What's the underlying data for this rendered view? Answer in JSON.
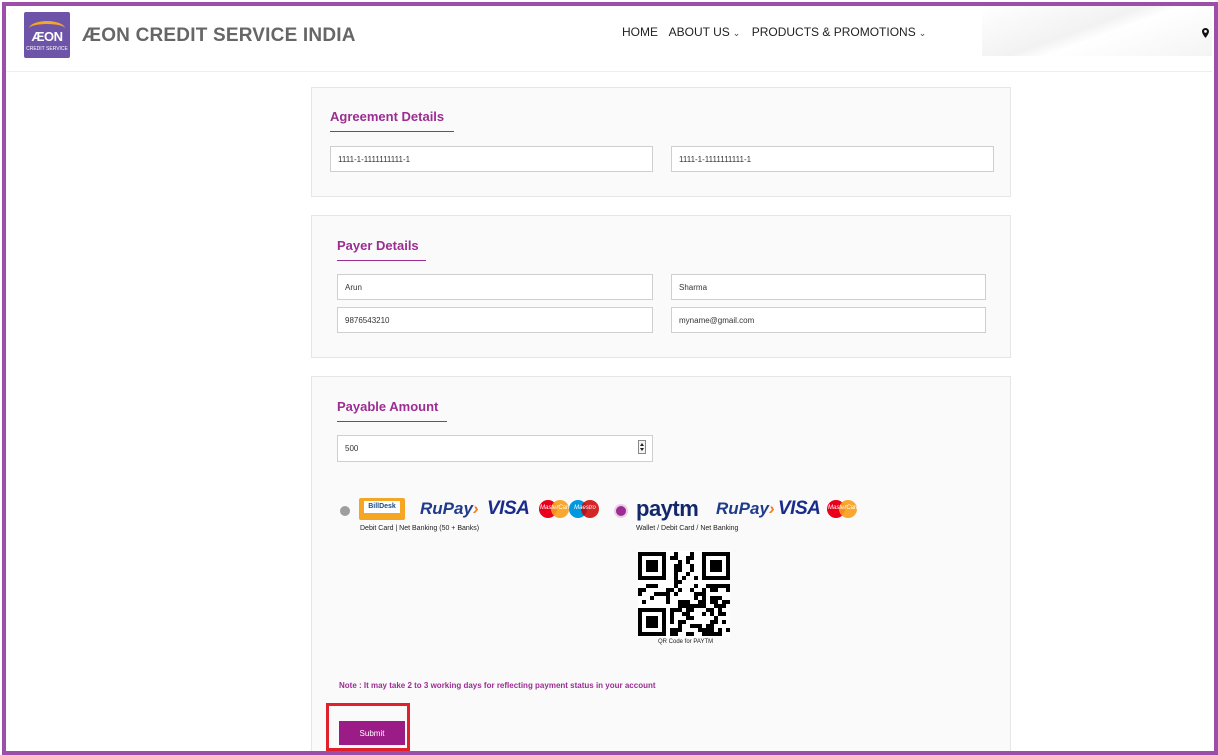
{
  "header": {
    "logo_text": "ÆON",
    "logo_sub": "CREDIT SERVICE",
    "brand": "ÆON CREDIT SERVICE INDIA",
    "nav": [
      {
        "label": "HOME",
        "has_dropdown": false
      },
      {
        "label": "ABOUT US",
        "has_dropdown": true
      },
      {
        "label": "PRODUCTS & PROMOTIONS",
        "has_dropdown": true
      }
    ],
    "pin_icon": "location-pin-icon"
  },
  "agreement": {
    "title": "Agreement Details",
    "field1": "1111-1-1111111111-1",
    "field2": "1111-1-1111111111-1"
  },
  "payer": {
    "title": "Payer Details",
    "first_name": "Arun",
    "last_name": "Sharma",
    "phone": "9876543210",
    "email": "myname@gmail.com"
  },
  "payable": {
    "title": "Payable Amount",
    "amount": "500",
    "options": [
      {
        "name": "billdesk",
        "selected": false,
        "logo_text": "BillDesk",
        "brands": [
          "RuPay",
          "VISA",
          "MasterCard",
          "Maestro"
        ],
        "label": "Debit Card | Net Banking (50 + Banks)"
      },
      {
        "name": "paytm",
        "selected": true,
        "logo_text": "paytm",
        "brands": [
          "RuPay",
          "VISA",
          "MasterCard"
        ],
        "label": "Wallet / Debit Card / Net Banking"
      }
    ],
    "qr_caption": "QR Code for PAYTM",
    "note": "Note : It may take 2 to 3 working days for reflecting payment status in your account",
    "submit_label": "Submit"
  },
  "colors": {
    "accent": "#9b2d93",
    "frame": "#9b4fa8",
    "submit": "#9b1c86",
    "highlight": "#e0212b"
  }
}
